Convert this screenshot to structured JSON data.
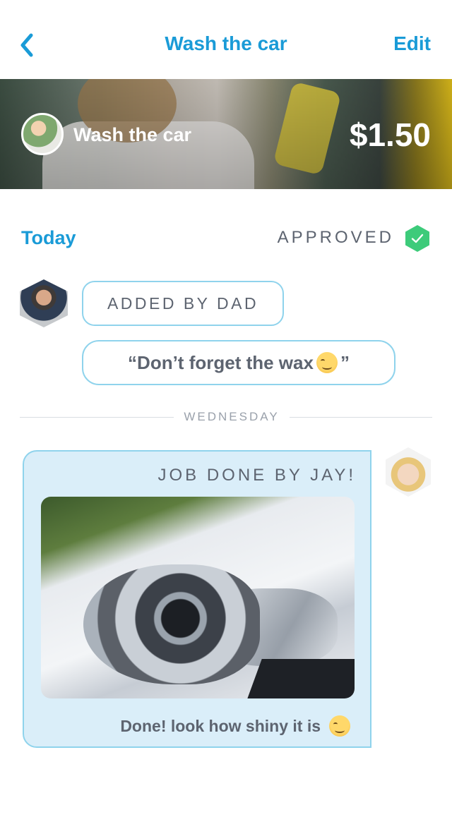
{
  "nav": {
    "back_icon": "chevron-left-icon",
    "title": "Wash the car",
    "edit_label": "Edit"
  },
  "hero": {
    "title": "Wash the car",
    "price": "$1.50"
  },
  "status": {
    "date_label": "Today",
    "state": "APPROVED",
    "state_icon": "check-hexagon-icon",
    "accent_color": "#3dcb7a"
  },
  "messages": {
    "added_by": "ADDED BY DAD",
    "note": "“Don’t forget the wax",
    "note_end": "”"
  },
  "divider": {
    "label": "WEDNESDAY"
  },
  "done": {
    "title": "JOB DONE BY JAY!",
    "caption": "Done! look how shiny it is"
  },
  "theme": {
    "primary": "#1a9bd7",
    "bubble_border": "#8fd3ec",
    "card_bg": "#daeef9"
  }
}
